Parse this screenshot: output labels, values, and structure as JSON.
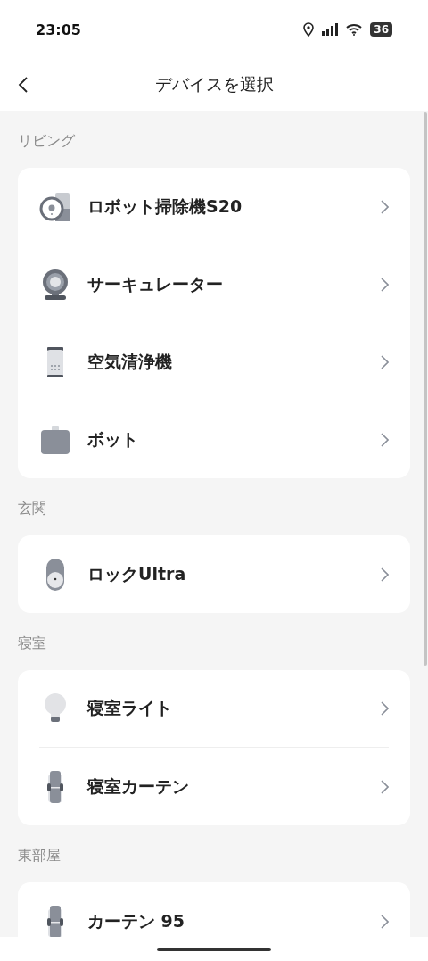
{
  "status_bar": {
    "time": "23:05",
    "battery": "36"
  },
  "header": {
    "title": "デバイスを選択"
  },
  "sections": [
    {
      "name": "リビング",
      "devices": [
        {
          "name": "ロボット掃除機S20",
          "kind": "robot",
          "separator": false
        },
        {
          "name": "サーキュレーター",
          "kind": "fan",
          "separator": false
        },
        {
          "name": "空気清浄機",
          "kind": "purifier",
          "separator": false
        },
        {
          "name": "ボット",
          "kind": "bot",
          "separator": false
        }
      ]
    },
    {
      "name": "玄関",
      "devices": [
        {
          "name": "ロックUltra",
          "kind": "lock",
          "separator": false
        }
      ]
    },
    {
      "name": "寝室",
      "devices": [
        {
          "name": "寝室ライト",
          "kind": "bulb",
          "separator": true
        },
        {
          "name": "寝室カーテン",
          "kind": "curtain",
          "separator": false
        }
      ]
    },
    {
      "name": "東部屋",
      "devices": [
        {
          "name": "カーテン 95",
          "kind": "curtain",
          "separator": false
        }
      ]
    }
  ]
}
